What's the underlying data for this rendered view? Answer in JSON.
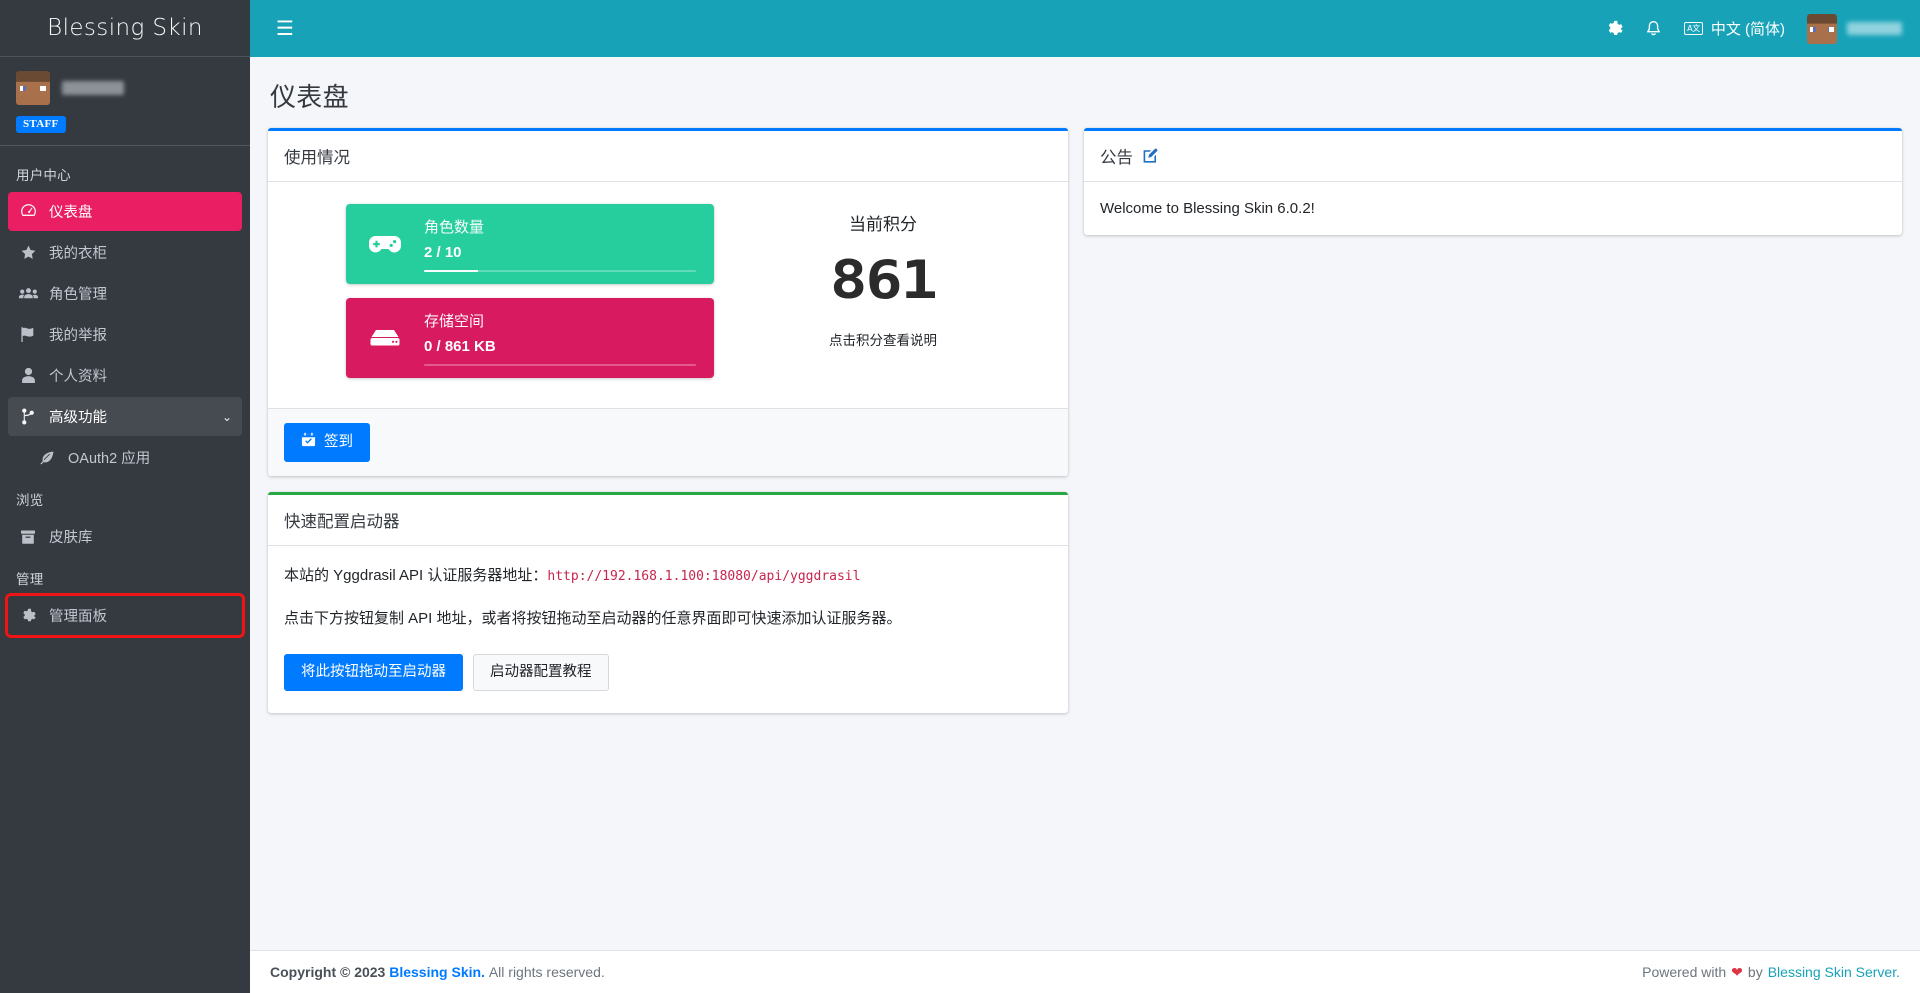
{
  "sidebar": {
    "brand": "Blessing Skin",
    "user": {
      "name_redacted": true,
      "badge": "STAFF"
    },
    "sections": [
      {
        "header": "用户中心",
        "items": [
          {
            "label": "仪表盘",
            "icon": "dashboard-icon",
            "state": "active"
          },
          {
            "label": "我的衣柜",
            "icon": "star-icon",
            "state": "normal"
          },
          {
            "label": "角色管理",
            "icon": "users-icon",
            "state": "normal"
          },
          {
            "label": "我的举报",
            "icon": "flag-icon",
            "state": "normal"
          },
          {
            "label": "个人资料",
            "icon": "user-icon",
            "state": "normal"
          },
          {
            "label": "高级功能",
            "icon": "code-branch-icon",
            "state": "open",
            "chevron": "⌄"
          }
        ],
        "sub_items": [
          {
            "label": "OAuth2 应用",
            "icon": "feather-icon"
          }
        ]
      },
      {
        "header": "浏览",
        "items": [
          {
            "label": "皮肤库",
            "icon": "box-icon",
            "state": "normal"
          }
        ]
      },
      {
        "header": "管理",
        "items": [
          {
            "label": "管理面板",
            "icon": "gear-icon",
            "state": "highlighted"
          }
        ]
      }
    ]
  },
  "topbar": {
    "menu_toggle": "☰",
    "gear_icon": "gear-icon",
    "bell_icon": "bell-icon",
    "language": "中文 (简体)",
    "language_badge": "A文",
    "user_name_redacted": true
  },
  "page": {
    "title": "仪表盘"
  },
  "usage_card": {
    "title": "使用情况",
    "boxes": [
      {
        "icon": "gamepad-icon",
        "label": "角色数量",
        "value": "2 / 10",
        "progress_percent": 20,
        "color": "#26ce9e"
      },
      {
        "icon": "hdd-icon",
        "label": "存储空间",
        "value": "0 / 861 KB",
        "progress_percent": 0,
        "color": "#d81b60"
      }
    ],
    "score": {
      "label": "当前积分",
      "value": "861",
      "hint": "点击积分查看说明"
    },
    "footer_button": {
      "label": "签到",
      "icon": "calendar-check-icon"
    }
  },
  "launcher_card": {
    "title": "快速配置启动器",
    "line1_prefix": "本站的 Yggdrasil API 认证服务器地址：",
    "api_url": "http://192.168.1.100:18080/api/yggdrasil",
    "line2": "点击下方按钮复制 API 地址，或者将按钮拖动至启动器的任意界面即可快速添加认证服务器。",
    "buttons": [
      {
        "label": "将此按钮拖动至启动器",
        "style": "primary"
      },
      {
        "label": "启动器配置教程",
        "style": "light"
      }
    ]
  },
  "announcement_card": {
    "title": "公告",
    "edit_icon": "edit-icon",
    "body": "Welcome to Blessing Skin 6.0.2!"
  },
  "footer": {
    "copyright_prefix": "Copyright © 2023",
    "brand_link": "Blessing Skin.",
    "rights": "All rights reserved.",
    "powered_prefix": "Powered with",
    "heart": "❤",
    "by": "by",
    "server_link": "Blessing Skin Server."
  },
  "colors": {
    "sidebar_bg": "#343a40",
    "topbar_bg": "#17a2b8",
    "active_nav": "#e91e63",
    "highlight_outline": "#f11414",
    "primary": "#007bff",
    "success": "#28a745",
    "green_box": "#26ce9e",
    "pink_box": "#d81b60",
    "api_url_color": "#c7254e"
  }
}
